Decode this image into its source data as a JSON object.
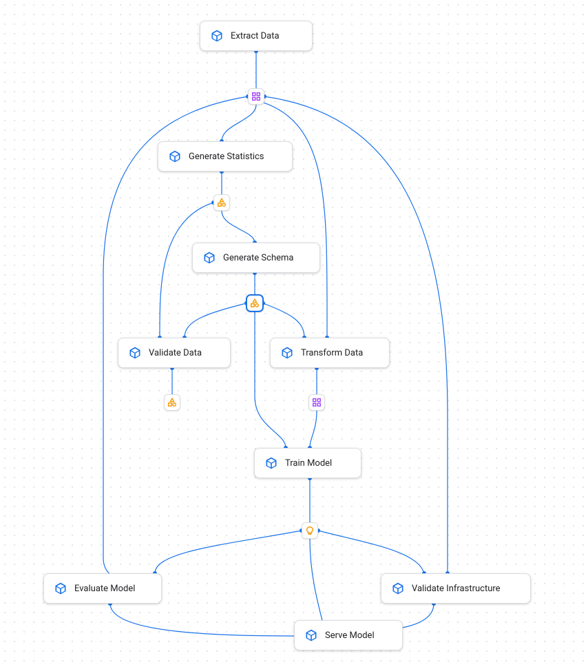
{
  "nodes": {
    "extract": {
      "label": "Extract Data"
    },
    "genstats": {
      "label": "Generate Statistics"
    },
    "genschema": {
      "label": "Generate Schema"
    },
    "validate": {
      "label": "Validate Data"
    },
    "transform": {
      "label": "Transform Data"
    },
    "train": {
      "label": "Train Model"
    },
    "evaluate": {
      "label": "Evaluate Model"
    },
    "valinfra": {
      "label": "Validate Infrastructure"
    },
    "serve": {
      "label": "Serve Model"
    }
  },
  "colors": {
    "edge": "#1a73e8",
    "cube": "#1a73e8",
    "shapes": "#f29900",
    "grid4": "#a142f4"
  },
  "junctions": {
    "j1": {
      "type": "grid4"
    },
    "j2": {
      "type": "shapes"
    },
    "j3": {
      "type": "shapes",
      "selected": true
    },
    "j4": {
      "type": "shapes"
    },
    "j5": {
      "type": "grid4"
    },
    "j6": {
      "type": "bulb"
    }
  }
}
